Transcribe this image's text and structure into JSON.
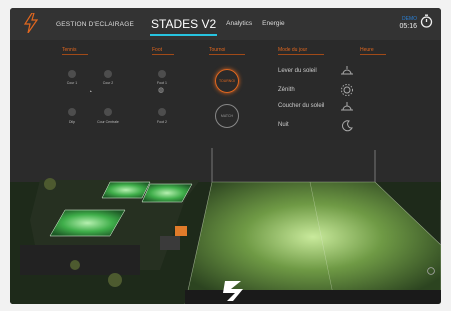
{
  "header": {
    "app_title": "GESTION D'ECLAIRAGE",
    "tabs": [
      {
        "label": "STADES V2",
        "active": true
      },
      {
        "label": "Analytics",
        "active": false
      },
      {
        "label": "Energie",
        "active": false
      }
    ],
    "demo_label": "DEMO",
    "time": "05:16",
    "logo_icon": "lightning-bolt-icon",
    "timer_icon": "stopwatch-icon"
  },
  "sections": {
    "tennis": "Tennis",
    "foot": "Foot",
    "tournoi": "Tournoi",
    "mode": "Mode du jour",
    "heure": "Heure"
  },
  "tennis_courts": [
    {
      "label": "Cour 1"
    },
    {
      "label": "Cour 2"
    },
    {
      "label": "Dilp"
    },
    {
      "label": "Cour Centrale"
    }
  ],
  "foot_fields": [
    {
      "label": "Foot 1"
    },
    {
      "label": "Foot 2"
    }
  ],
  "tournoi_buttons": [
    {
      "label": "TOURNOI",
      "active": true
    },
    {
      "label": "MATCH",
      "active": false
    }
  ],
  "modes": [
    {
      "label": "Lever du soleil",
      "icon": "sunrise-icon"
    },
    {
      "label": "Zénith",
      "icon": "sun-icon"
    },
    {
      "label": "Coucher du soleil",
      "icon": "sunset-icon"
    },
    {
      "label": "Nuit",
      "icon": "moon-icon"
    }
  ],
  "colors": {
    "accent": "#e1671f",
    "tab_underline": "#27c4e0",
    "court_green": "#3fae4a",
    "field_green": "#5a8a3a"
  }
}
